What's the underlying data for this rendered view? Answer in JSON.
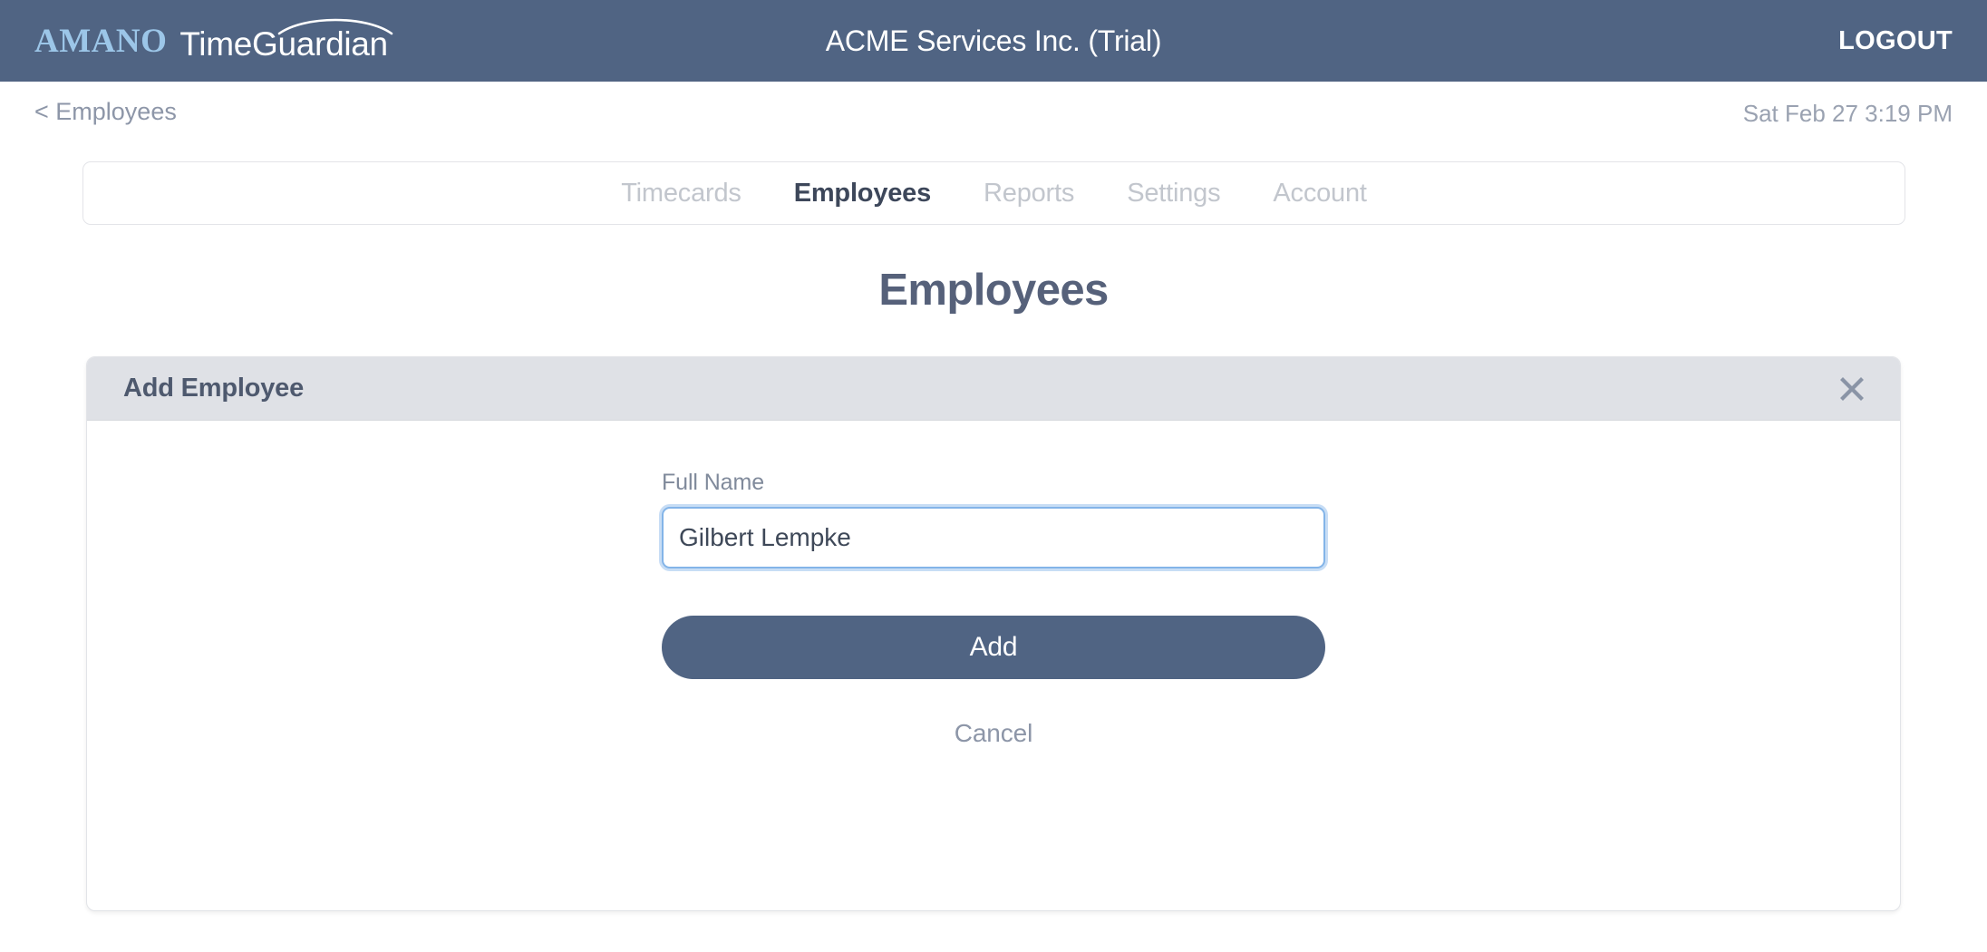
{
  "header": {
    "brand_amano": "AMANO",
    "brand_product": "TimeGuardian",
    "company": "ACME Services Inc. (Trial)",
    "logout_label": "LOGOUT",
    "bar_color": "#506483",
    "brand_accent_color": "#9cc6e8"
  },
  "subheader": {
    "back_label": "< Employees",
    "clock": "Sat Feb 27 3:19 PM"
  },
  "nav": {
    "tabs": [
      {
        "label": "Timecards",
        "active": false
      },
      {
        "label": "Employees",
        "active": true
      },
      {
        "label": "Reports",
        "active": false
      },
      {
        "label": "Settings",
        "active": false
      },
      {
        "label": "Account",
        "active": false
      }
    ]
  },
  "page": {
    "title": "Employees"
  },
  "card": {
    "title": "Add Employee",
    "close_icon": "close-icon",
    "form": {
      "full_name": {
        "label": "Full Name",
        "value": "Gilbert Lempke",
        "placeholder": "",
        "focused": true,
        "focus_border_color": "#83b4e8"
      }
    },
    "submit_label": "Add",
    "submit_color": "#506483",
    "cancel_label": "Cancel"
  }
}
